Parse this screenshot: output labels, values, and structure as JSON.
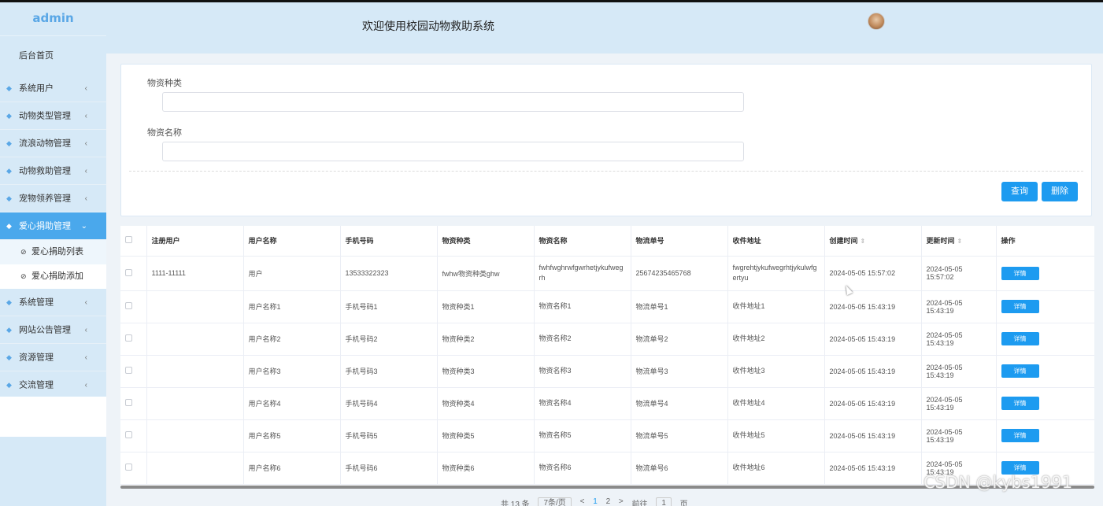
{
  "sidebar": {
    "logo": "admin",
    "home": "后台首页",
    "items": [
      {
        "label": "系统用户"
      },
      {
        "label": "动物类型管理"
      },
      {
        "label": "流浪动物管理"
      },
      {
        "label": "动物救助管理"
      },
      {
        "label": "宠物领养管理"
      },
      {
        "label": "爱心捐助管理",
        "active": true,
        "children": [
          {
            "label": "爱心捐助列表"
          },
          {
            "label": "爱心捐助添加"
          }
        ]
      },
      {
        "label": "系统管理"
      },
      {
        "label": "网站公告管理"
      },
      {
        "label": "资源管理"
      },
      {
        "label": "交流管理"
      }
    ]
  },
  "header": {
    "title": "欢迎使用校园动物救助系统"
  },
  "search": {
    "category_label": "物资种类",
    "category_value": "",
    "name_label": "物资名称",
    "name_value": "",
    "query_button": "查询",
    "delete_button": "删除"
  },
  "table": {
    "columns": [
      "注册用户",
      "用户名称",
      "手机号码",
      "物资种类",
      "物资名称",
      "物流单号",
      "收件地址",
      "创建时间",
      "更新时间",
      "操作"
    ],
    "detail_label": "详情",
    "rows": [
      [
        "1111-11111",
        "用户",
        "13533322323",
        "fwhw物资种类ghw",
        "fwhfwghrwfgwrhetjykufwegrh",
        "25674235465768",
        "fwgrehtjykufwegrhtjykulwfgertyu",
        "2024-05-05 15:57:02",
        "2024-05-05 15:57:02"
      ],
      [
        "",
        "用户名称1",
        "手机号码1",
        "物资种类1",
        "物资名称1",
        "物流单号1",
        "收件地址1",
        "2024-05-05 15:43:19",
        "2024-05-05 15:43:19"
      ],
      [
        "",
        "用户名称2",
        "手机号码2",
        "物资种类2",
        "物资名称2",
        "物流单号2",
        "收件地址2",
        "2024-05-05 15:43:19",
        "2024-05-05 15:43:19"
      ],
      [
        "",
        "用户名称3",
        "手机号码3",
        "物资种类3",
        "物资名称3",
        "物流单号3",
        "收件地址3",
        "2024-05-05 15:43:19",
        "2024-05-05 15:43:19"
      ],
      [
        "",
        "用户名称4",
        "手机号码4",
        "物资种类4",
        "物资名称4",
        "物流单号4",
        "收件地址4",
        "2024-05-05 15:43:19",
        "2024-05-05 15:43:19"
      ],
      [
        "",
        "用户名称5",
        "手机号码5",
        "物资种类5",
        "物资名称5",
        "物流单号5",
        "收件地址5",
        "2024-05-05 15:43:19",
        "2024-05-05 15:43:19"
      ],
      [
        "",
        "用户名称6",
        "手机号码6",
        "物资种类6",
        "物资名称6",
        "物流单号6",
        "收件地址6",
        "2024-05-05 15:43:19",
        "2024-05-05 15:43:19"
      ]
    ]
  },
  "pagination": {
    "total": "共 13 条",
    "page_size": "7条/页",
    "prev": "<",
    "pages": [
      "1",
      "2"
    ],
    "next": ">",
    "goto_label": "前往",
    "goto_value": "1",
    "goto_suffix": "页"
  },
  "watermark": "CSDN @kybs1991",
  "colors": {
    "primary": "#1d9bf0",
    "sidebar_bg": "#d6e9f7",
    "active_menu": "#4aa8ec"
  }
}
